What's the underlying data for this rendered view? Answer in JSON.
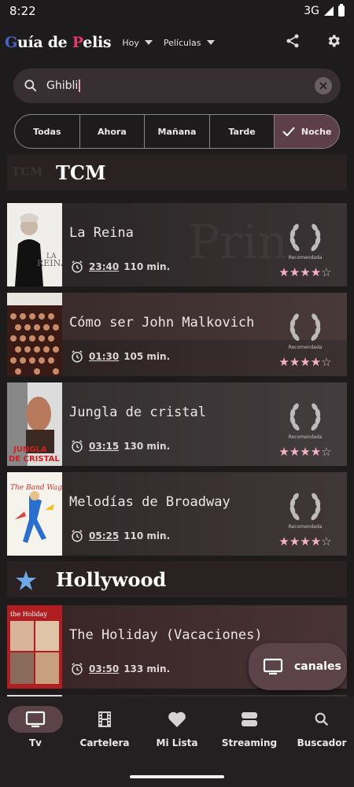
{
  "status": {
    "time": "8:22",
    "network": "3G"
  },
  "app": {
    "logo_g": "G",
    "logo_mid": "uía de ",
    "logo_p": "P",
    "logo_end": "elis",
    "menu_day": "Hoy",
    "menu_type": "Películas"
  },
  "search": {
    "value": "Ghibli"
  },
  "filters": [
    "Todas",
    "Ahora",
    "Mañana",
    "Tarde",
    "Noche"
  ],
  "filter_selected": "Noche",
  "channels": [
    {
      "name": "TCM",
      "logo_text": "TCM"
    },
    {
      "name": "Hollywood"
    }
  ],
  "movies": [
    {
      "title": "La Reina",
      "time": "23:40",
      "duration": "110 min.",
      "award": "Recomendada",
      "rating": 4
    },
    {
      "title": "Cómo ser John Malkovich",
      "time": "01:30",
      "duration": "105 min.",
      "award": "Recomendada",
      "rating": 4
    },
    {
      "title": "Jungla de cristal",
      "time": "03:15",
      "duration": "130 min.",
      "award": "Recomendada",
      "rating": 4
    },
    {
      "title": "Melodías de Broadway",
      "time": "05:25",
      "duration": "110 min.",
      "award": "Recomendada",
      "rating": 4
    },
    {
      "title": "The Holiday (Vacaciones)",
      "time": "03:50",
      "duration": "133 min.",
      "award": "Recomendada",
      "rating": 4
    }
  ],
  "fab": {
    "label": "canales"
  },
  "nav": [
    {
      "label": "Tv",
      "icon": "tv-icon",
      "active": true
    },
    {
      "label": "Cartelera",
      "icon": "film-icon"
    },
    {
      "label": "Mi Lista",
      "icon": "heart-icon"
    },
    {
      "label": "Streaming",
      "icon": "streaming-icon"
    },
    {
      "label": "Buscador",
      "icon": "search-icon"
    }
  ],
  "colors": {
    "accent": "#5b4349",
    "background": "#1e1b1c",
    "star": "#f4b0c8",
    "logo_blue": "#4a63c8",
    "logo_pink": "#e23a6a"
  }
}
